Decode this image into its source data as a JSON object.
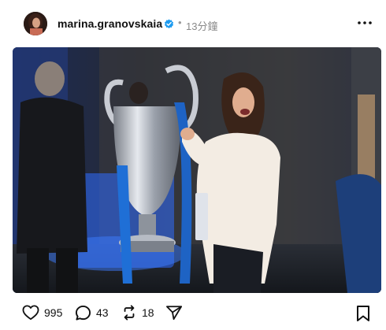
{
  "post": {
    "username": "marina.granovskaia",
    "verified": true,
    "time_ago": "13分鐘",
    "more_icon": "more-dots-icon"
  },
  "actions": {
    "likes": "995",
    "comments": "43",
    "reposts": "18",
    "icons": {
      "like": "heart-icon",
      "comment": "comment-bubble-icon",
      "repost": "repost-arrows-icon",
      "share": "send-paper-plane-icon",
      "save": "bookmark-icon"
    }
  },
  "colors": {
    "verified": "#1d9bf0",
    "text": "#111111",
    "muted": "#8a8a8a"
  }
}
